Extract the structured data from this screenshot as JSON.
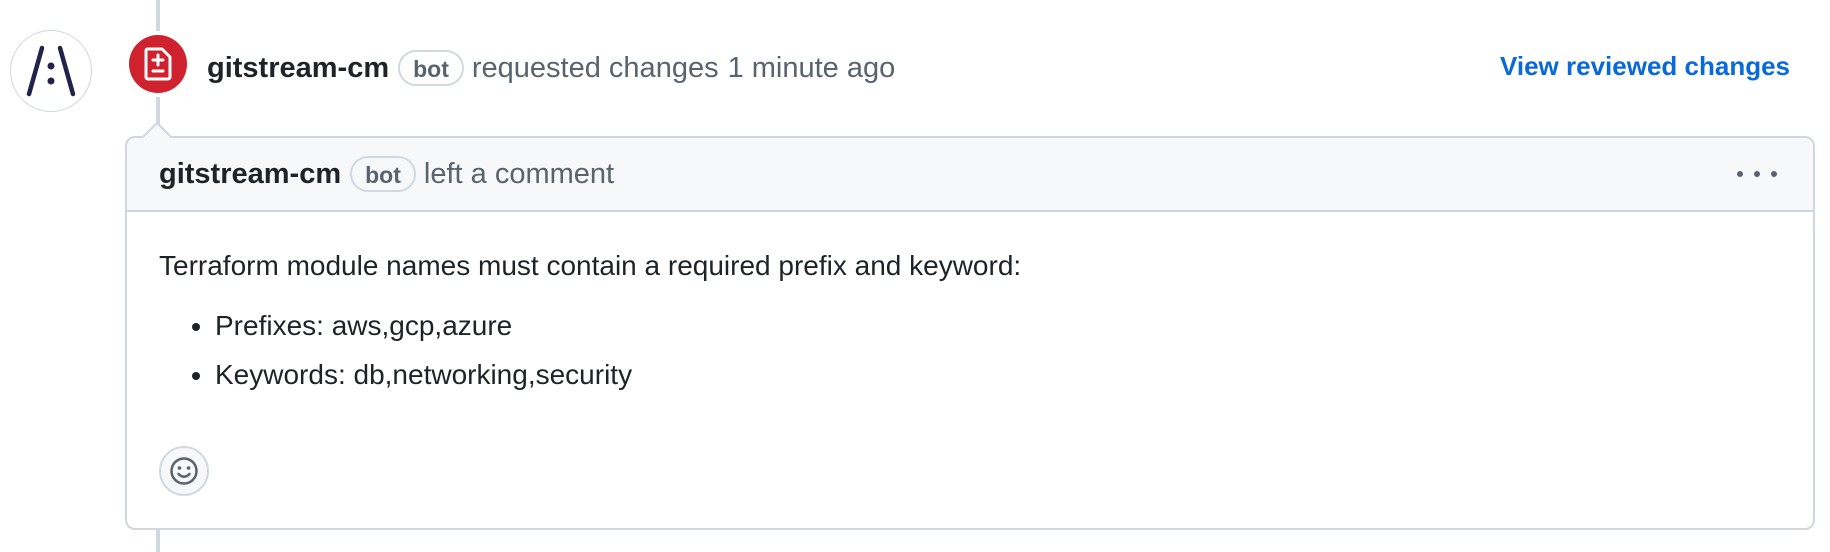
{
  "review": {
    "author": "gitstream-cm",
    "bot_label": "bot",
    "action": "requested changes",
    "time": "1 minute ago",
    "view_link": "View reviewed changes",
    "status_color": "#cf222e",
    "status_icon": "file-diff-icon"
  },
  "comment": {
    "author": "gitstream-cm",
    "bot_label": "bot",
    "action": "left a comment",
    "menu_icon": "kebab-horizontal-icon",
    "intro": "Terraform module names must contain a required prefix and keyword:",
    "items": [
      "Prefixes: aws,gcp,azure",
      "Keywords: db,networking,security"
    ],
    "reaction_icon": "smiley-icon"
  },
  "colors": {
    "link": "#0969da",
    "border": "#d0d7de",
    "header_bg": "#f6f8fa",
    "muted_text": "#59636e"
  }
}
